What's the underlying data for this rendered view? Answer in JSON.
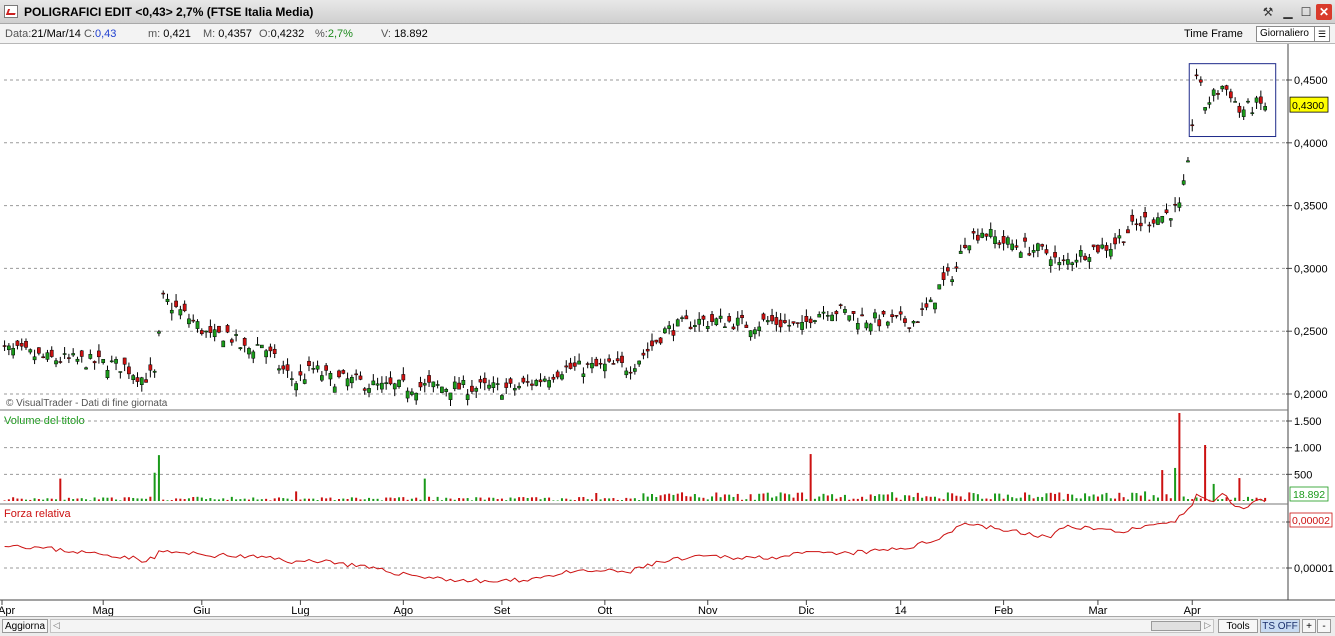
{
  "window": {
    "title": "POLIGRAFICI EDIT <0,43> 2,7%  (FTSE Italia Media)",
    "buttons": {
      "tools": "⚒",
      "minimize": "▁",
      "maximize": "☐",
      "close": "✕"
    }
  },
  "info": {
    "date_label": "Data:",
    "date": "21/Mar/14",
    "close_label": "C:",
    "close": "0,43",
    "min_label": "m:",
    "min": "0,421",
    "max_label": "M:",
    "max": "0,4357",
    "open_label": "O:",
    "open": "0,4232",
    "pct_label": "%:",
    "pct": "2,7%",
    "vol_label": "V:",
    "vol": "18.892"
  },
  "timeframe": {
    "label": "Time Frame",
    "value": "Giornaliero"
  },
  "bottom": {
    "refresh": "Aggiorna",
    "tools": "Tools",
    "ts": "TS OFF",
    "plus": "+",
    "minus": "-"
  },
  "colors": {
    "up": "#1a9a1a",
    "down": "#cc1111",
    "rel": "#cc1111",
    "grid": "#9a9a9a",
    "highlight": "#ffff00",
    "box": "#1e2a8a"
  },
  "chart_data": [
    {
      "type": "candlestick",
      "watermark": "© VisualTrader - Dati di fine giornata",
      "ylim": [
        0.2,
        0.47
      ],
      "yticks": [
        "0,4500",
        "0,4000",
        "0,3500",
        "0,3000",
        "0,2500",
        "0,2000"
      ],
      "last_value_label": "0,4300",
      "months": [
        "Apr",
        "Mag",
        "Giu",
        "Lug",
        "Ago",
        "Set",
        "Ott",
        "Nov",
        "Dic",
        "14",
        "Feb",
        "Mar",
        "Apr"
      ],
      "close_path": [
        [
          0,
          0.236
        ],
        [
          6,
          0.233
        ],
        [
          12,
          0.228
        ],
        [
          18,
          0.227
        ],
        [
          24,
          0.225
        ],
        [
          30,
          0.222
        ],
        [
          34,
          0.213
        ],
        [
          37,
          0.215
        ],
        [
          38,
          0.245
        ],
        [
          39,
          0.275
        ],
        [
          42,
          0.268
        ],
        [
          46,
          0.258
        ],
        [
          50,
          0.245
        ],
        [
          54,
          0.248
        ],
        [
          58,
          0.235
        ],
        [
          62,
          0.24
        ],
        [
          66,
          0.222
        ],
        [
          70,
          0.21
        ],
        [
          74,
          0.22
        ],
        [
          78,
          0.212
        ],
        [
          84,
          0.21
        ],
        [
          90,
          0.205
        ],
        [
          96,
          0.206
        ],
        [
          102,
          0.206
        ],
        [
          108,
          0.205
        ],
        [
          114,
          0.205
        ],
        [
          120,
          0.204
        ],
        [
          126,
          0.21
        ],
        [
          132,
          0.22
        ],
        [
          138,
          0.221
        ],
        [
          144,
          0.222
        ],
        [
          148,
          0.222
        ],
        [
          152,
          0.235
        ],
        [
          156,
          0.25
        ],
        [
          160,
          0.255
        ],
        [
          164,
          0.258
        ],
        [
          170,
          0.258
        ],
        [
          176,
          0.255
        ],
        [
          180,
          0.258
        ],
        [
          184,
          0.256
        ],
        [
          188,
          0.252
        ],
        [
          190,
          0.262
        ],
        [
          194,
          0.268
        ],
        [
          198,
          0.265
        ],
        [
          202,
          0.26
        ],
        [
          208,
          0.258
        ],
        [
          214,
          0.258
        ],
        [
          218,
          0.27
        ],
        [
          220,
          0.285
        ],
        [
          224,
          0.3
        ],
        [
          226,
          0.322
        ],
        [
          230,
          0.33
        ],
        [
          234,
          0.322
        ],
        [
          238,
          0.318
        ],
        [
          242,
          0.315
        ],
        [
          246,
          0.312
        ],
        [
          248,
          0.302
        ],
        [
          252,
          0.31
        ],
        [
          256,
          0.316
        ],
        [
          260,
          0.318
        ],
        [
          264,
          0.33
        ],
        [
          268,
          0.338
        ],
        [
          272,
          0.342
        ],
        [
          276,
          0.348
        ],
        [
          278,
          0.38
        ],
        [
          280,
          0.455
        ],
        [
          282,
          0.43
        ],
        [
          286,
          0.445
        ],
        [
          288,
          0.44
        ],
        [
          290,
          0.425
        ],
        [
          294,
          0.43
        ]
      ],
      "highlight_box": {
        "from": 0.405,
        "to": 0.463
      }
    },
    {
      "type": "bar",
      "title": "Volume del titolo",
      "yticks": [
        "1.500",
        "1.000",
        "500"
      ],
      "ylim": [
        0,
        1700
      ],
      "last_value_label": "18.892",
      "spikes": [
        [
          15,
          420
        ],
        [
          37,
          530
        ],
        [
          38,
          860
        ],
        [
          70,
          180
        ],
        [
          100,
          420
        ],
        [
          140,
          150
        ],
        [
          190,
          880
        ],
        [
          222,
          160
        ],
        [
          268,
          180
        ],
        [
          272,
          580
        ],
        [
          275,
          620
        ],
        [
          276,
          1650
        ],
        [
          282,
          1050
        ],
        [
          284,
          320
        ],
        [
          290,
          430
        ]
      ]
    },
    {
      "type": "line",
      "title": "Forza relativa",
      "yticks": [
        "0,00002",
        "0,00001"
      ],
      "last_value_label": "0,00002",
      "values": [
        [
          0,
          0.88
        ],
        [
          8,
          0.82
        ],
        [
          16,
          0.76
        ],
        [
          24,
          0.7
        ],
        [
          30,
          0.66
        ],
        [
          34,
          0.6
        ],
        [
          37,
          0.62
        ],
        [
          38,
          0.75
        ],
        [
          42,
          0.72
        ],
        [
          50,
          0.68
        ],
        [
          58,
          0.66
        ],
        [
          66,
          0.62
        ],
        [
          70,
          0.56
        ],
        [
          76,
          0.6
        ],
        [
          84,
          0.5
        ],
        [
          92,
          0.4
        ],
        [
          100,
          0.32
        ],
        [
          108,
          0.26
        ],
        [
          114,
          0.24
        ],
        [
          120,
          0.25
        ],
        [
          126,
          0.3
        ],
        [
          132,
          0.38
        ],
        [
          140,
          0.42
        ],
        [
          148,
          0.4
        ],
        [
          152,
          0.52
        ],
        [
          158,
          0.6
        ],
        [
          166,
          0.66
        ],
        [
          176,
          0.64
        ],
        [
          184,
          0.66
        ],
        [
          190,
          0.72
        ],
        [
          196,
          0.7
        ],
        [
          204,
          0.74
        ],
        [
          212,
          0.8
        ],
        [
          218,
          0.9
        ],
        [
          222,
          1.06
        ],
        [
          226,
          1.22
        ],
        [
          232,
          1.14
        ],
        [
          240,
          1.04
        ],
        [
          246,
          0.98
        ],
        [
          250,
          1.18
        ],
        [
          256,
          1.12
        ],
        [
          262,
          1.08
        ],
        [
          268,
          1.14
        ],
        [
          274,
          1.2
        ],
        [
          278,
          1.42
        ],
        [
          280,
          1.68
        ],
        [
          284,
          1.58
        ],
        [
          286,
          1.7
        ],
        [
          290,
          1.46
        ],
        [
          294,
          1.58
        ]
      ]
    }
  ]
}
